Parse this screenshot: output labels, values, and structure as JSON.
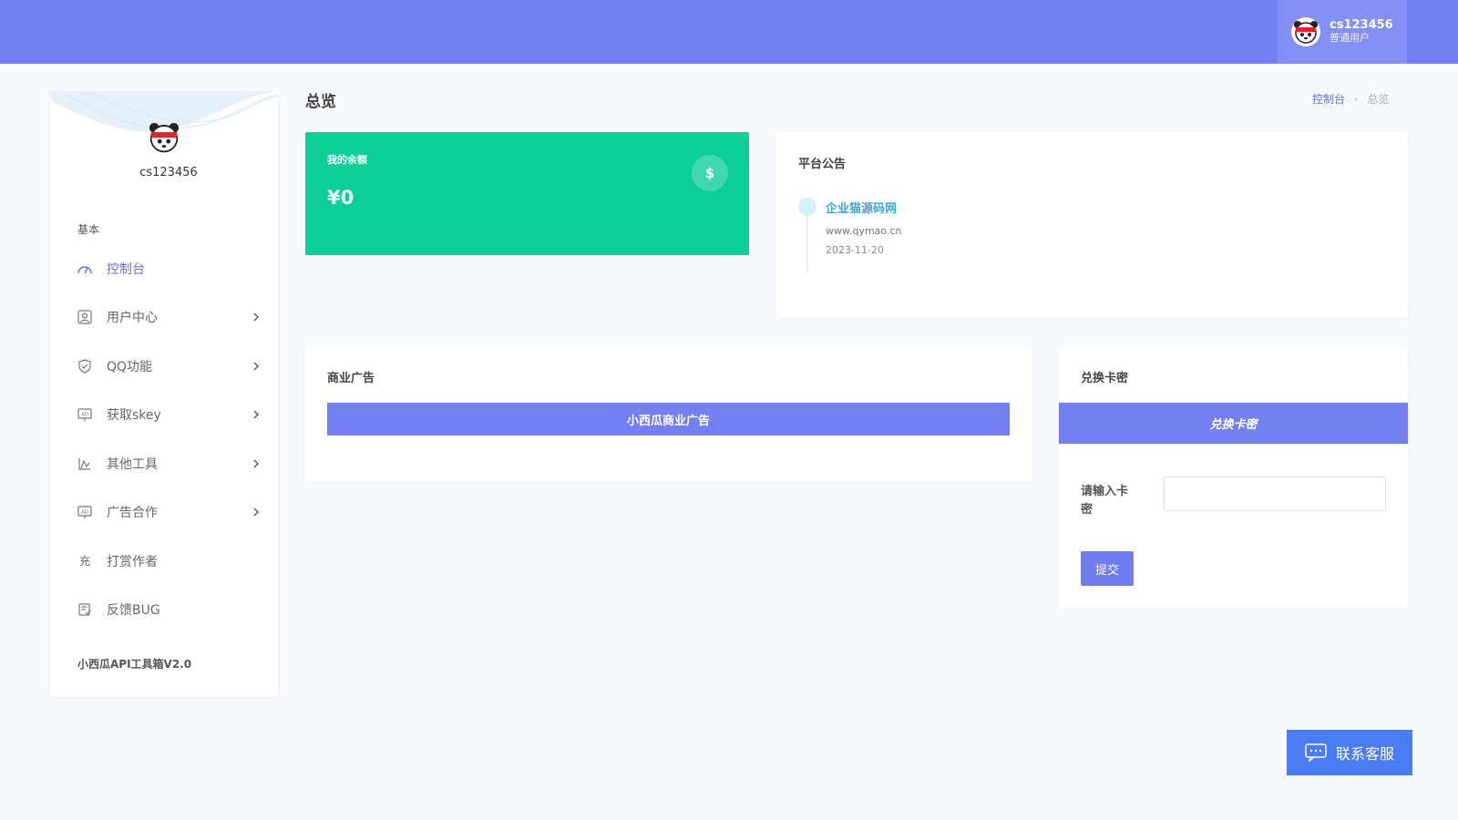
{
  "header": {
    "user_name": "cs123456",
    "user_role": "普通用户",
    "avatar_icon": "panda-avatar-icon"
  },
  "sidebar": {
    "user_name": "cs123456",
    "section_label": "基本",
    "items": [
      {
        "label": "控制台",
        "icon": "dashboard-icon",
        "active": true,
        "has_submenu": false
      },
      {
        "label": "用户中心",
        "icon": "user-icon",
        "active": false,
        "has_submenu": true
      },
      {
        "label": "QQ功能",
        "icon": "shield-icon",
        "active": false,
        "has_submenu": true
      },
      {
        "label": "获取skey",
        "icon": "ad-icon",
        "active": false,
        "has_submenu": true
      },
      {
        "label": "其他工具",
        "icon": "chart-icon",
        "active": false,
        "has_submenu": true
      },
      {
        "label": "广告合作",
        "icon": "ad-icon",
        "active": false,
        "has_submenu": true
      },
      {
        "label": "打赏作者",
        "icon": "charge-icon",
        "icon_text": "充",
        "active": false,
        "has_submenu": false
      },
      {
        "label": "反馈BUG",
        "icon": "feedback-icon",
        "active": false,
        "has_submenu": false
      }
    ],
    "footer": "小西瓜API工具箱V2.0"
  },
  "page": {
    "title": "总览",
    "breadcrumb": {
      "link": "控制台",
      "separator": "›",
      "current": "总览"
    }
  },
  "balance": {
    "label": "我的余额",
    "value": "¥0",
    "icon": "dollar-icon",
    "icon_text": "$",
    "color": "#0ccf95"
  },
  "announcement": {
    "title": "平台公告",
    "items": [
      {
        "title": "企业猫源码网",
        "url": "www.qymao.cn",
        "date": "2023-11-20"
      }
    ]
  },
  "ads": {
    "title": "商业广告",
    "banner": "小西瓜商业广告"
  },
  "redeem": {
    "title": "兑换卡密",
    "banner": "兑换卡密",
    "input_label": "请输入卡密",
    "input_placeholder": "",
    "submit_label": "提交"
  },
  "contact": {
    "label": "联系客服",
    "icon": "chat-icon"
  },
  "colors": {
    "topbar": "#7280f4",
    "accent": "#6571e8",
    "success": "#0ccf95",
    "contact": "#4a7cf6",
    "background": "#f8f9fd"
  }
}
